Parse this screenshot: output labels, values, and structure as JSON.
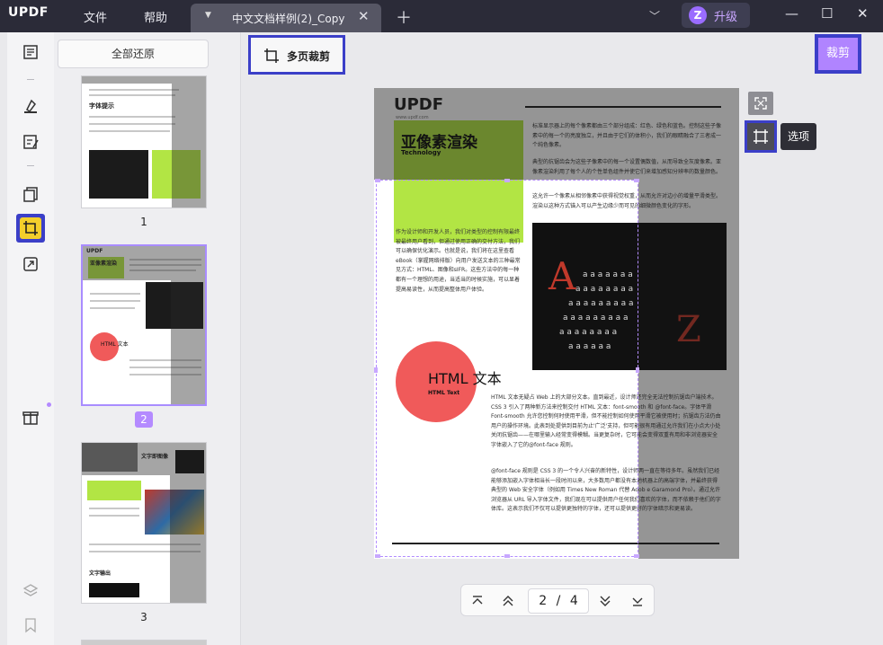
{
  "app": {
    "logo_text": "UPDF"
  },
  "menu": {
    "file": "文件",
    "help": "帮助"
  },
  "tab": {
    "title": "中文文档样例(2)_Copy"
  },
  "account": {
    "avatar_letter": "Z",
    "upgrade_label": "升级"
  },
  "toolbar": {
    "restore_all": "全部还原",
    "multi_page_crop": "多页裁剪",
    "crop": "裁剪",
    "options_tooltip": "选项"
  },
  "thumbnails": [
    {
      "page": "1",
      "selected": false
    },
    {
      "page": "2",
      "selected": true
    },
    {
      "page": "3",
      "selected": false
    }
  ],
  "thumb1": {
    "heading": "字体提示"
  },
  "thumb2": {
    "logo": "UPDF",
    "title": "亚像素渲染",
    "html_title": "HTML 文本"
  },
  "thumb3": {
    "title": "文字即图像",
    "bottom": "文字输出"
  },
  "document": {
    "logo": "UPDF",
    "logo_url": "www.updf.com",
    "title": "亚像素渲染",
    "title_en": "Technology",
    "right_para1": "标准显示器上的每个像素都由三个部分组成：红色、绿色和蓝色。控制这些子像素中的每一个的亮度独立，并且由于它们的体积小，我们的眼睛融合了三者成一个纯色像素。",
    "right_para2": "典型的抗锯齿会为这些子像素中的每一个设置偶数值，从而导致全灰度像素。亚像素渲染利用了每个人的个性单色组件并使它们来增加感知分辨率的数量颜色。",
    "right_para3": "这允许一个像素从相邻像素中获得视觉权重，从而允许对边小的增量平滑类型。渲染以这种方式锚入可以产生边缘少而可见的细微颜色变化的字形。",
    "left_para": "作为设计师和开发人员，我们对类型的控制有限最终被最终用户看到，但通过使用正确的交付方法，我们可以确保优化演示。也就是说，我们将在这里查看 eBook（掌握网络排版）向用户发送文本的三种最常见方式：HTML、图像和sIFR。这些方法中的每一种都有一个理想的用途，当适当的时候实施，可以显着提高易读性，从而提高整体用户体验。",
    "html_title": "HTML 文本",
    "html_sub": "HTML Text",
    "html_para1": "HTML 文本无疑占 Web 上的大部分文本。直到最近，设计师还完全无法控制抗锯齿户端技术。CSS 3 引入了两种新方法来控制交付 HTML 文本：font-smooth 和 @font-face。字体平滑Font-smooth 允许您控制何时使用平滑，但不能控制如何使用平滑它被使用时；抗锯齿方法仍由用户的操作环境。此表到处提供到目前为止'广泛'支持，但可能很有用通过允许我们在小点大小处关闭抗锯齿——在哪里输入经常变得模糊。当更复杂时，它可能会变得双重有用和非浏览器安全字体嵌入了它的@font-face 规则。",
    "html_para2": "@font-face 规则是 CSS 3 的一个令人兴奋的新特性，设计师两一直在等待多年。虽然我们已经能够添加嵌入字体相当长一段时间以来，大多数用户都没有本地机器上的高端字体，并最终获得典型的 Web 安全字体（例如用 Times New Roman 代替 Adob e Garamond Pro）。通过允许浏览器从 URL 导入字体文件，我们现在可以提供用户任何我们喜欢的字体，而不依赖于他们的字体库。这表示我们不仅可以提供更独特的字体，还可以提供更好的字体暗示和更易读。"
  },
  "pager": {
    "current": "2",
    "separator": "/",
    "total": "4"
  }
}
